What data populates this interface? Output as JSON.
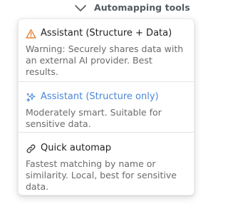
{
  "header": {
    "automapping_tools_label": "Automapping tools",
    "chevron_icon": "chevron-down-icon"
  },
  "menu": {
    "items": [
      {
        "icon": "warning-icon",
        "title": "Assistant (Structure + Data)",
        "description": "Warning: Securely shares data with an external AI provider. Best results."
      },
      {
        "icon": "sparkles-icon",
        "title": "Assistant (Structure only)",
        "description": "Moderately smart. Suitable for sensitive data."
      },
      {
        "icon": "link-icon",
        "title": "Quick automap",
        "description": "Fastest matching by name or similarity. Local, best for sensitive data."
      }
    ]
  },
  "colors": {
    "warning_orange": "#e07b2c",
    "accent_blue": "#4a87d8",
    "title_text": "#1f1f1f",
    "description_text": "#6b6b6b"
  }
}
